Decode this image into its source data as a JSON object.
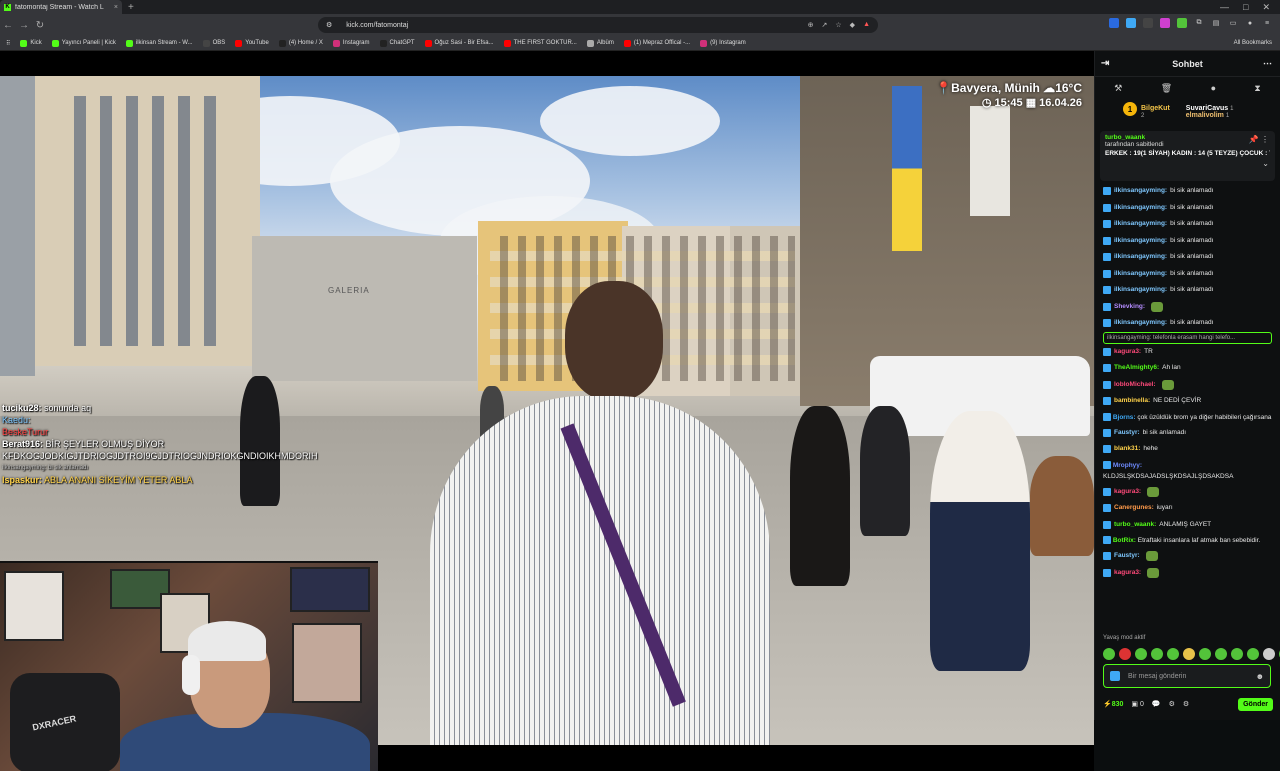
{
  "browser": {
    "tab_title": "fatomontaj Stream - Watch L",
    "tab_close": "×",
    "new_tab": "+",
    "url": "kick.com/fatomontaj",
    "bookmarks": [
      "Kick",
      "Yayıncı Paneli | Kick",
      "ilkinsan Stream - W...",
      "OBS",
      "YouTube",
      "(4) Home / X",
      "Instagram",
      "ChatGPT",
      "Oğuz Sasi - Bir Efsa...",
      "THE FIRST GOKTUR...",
      "Albüm",
      "(1) Mepraz Offical -...",
      "(9) Instagram"
    ],
    "all_bookmarks": "All Bookmarks"
  },
  "stream": {
    "location": "Bavyera, Münih",
    "temp": "16°C",
    "time": "15:45",
    "date": "16.04.26",
    "store_sign": "GALERIA"
  },
  "overlay_chat": [
    {
      "user": "tuciku28:",
      "text": "sonunda aq",
      "color": "#ffffff"
    },
    {
      "user": "",
      "text": "Kaedu:",
      "color": "#7fc8ff"
    },
    {
      "user": "",
      "text": "BeskeTurur",
      "color": "#ff4040"
    },
    {
      "user": "Berat916:",
      "text": "BİR ŞEYLER OLMUŞ DİYOR",
      "color": "#ffffff"
    },
    {
      "user": "",
      "text": "KFDKOGJODKIGJTDRIOGJDTROI9GJDTRIOGJNDRIOKGNDIOIKHMDORIH",
      "color": "#ffffff"
    },
    {
      "user": "",
      "text": "ilkinsangayming: bi sik anlamadı",
      "color": "#bbbbbb"
    },
    {
      "user": "lspaskur:",
      "text": "ABLA ANANI SİKEYİM YETER ABLA",
      "color": "#ffd24a"
    }
  ],
  "cam": {
    "chair_text": "DXRACER"
  },
  "chat": {
    "title": "Sohbet",
    "gifters": [
      {
        "rank": "1",
        "name": "BilgeKut",
        "count": "2"
      },
      {
        "name": "SuvariCavus",
        "count": "1"
      },
      {
        "name": "elmalivolim",
        "count": "1"
      }
    ],
    "pinned": {
      "by": "turbo_waank",
      "by_suffix": "tarafından sabitlendi",
      "text": "ERKEK : 19(1 SİYAH) KADIN : 14 (5 TEYZE) ÇOCUK : 7 SİYAH SAÇLI KIZ..."
    },
    "messages": [
      {
        "user": "ilkinsangayming:",
        "text": "bi sik anlamadı",
        "color": "#7fc8ff"
      },
      {
        "user": "ilkinsangayming:",
        "text": "bi sik anlamadı",
        "color": "#7fc8ff"
      },
      {
        "user": "ilkinsangayming:",
        "text": "bi sik anlamadı",
        "color": "#7fc8ff"
      },
      {
        "user": "ilkinsangayming:",
        "text": "bi sik anlamadı",
        "color": "#7fc8ff"
      },
      {
        "user": "ilkinsangayming:",
        "text": "bi sik anlamadı",
        "color": "#7fc8ff"
      },
      {
        "user": "ilkinsangayming:",
        "text": "bi sik anlamadı",
        "color": "#7fc8ff"
      },
      {
        "user": "ilkinsangayming:",
        "text": "bi sik anlamadı",
        "color": "#7fc8ff"
      },
      {
        "user": "Shevking:",
        "text": "",
        "color": "#b48cff"
      },
      {
        "user": "ilkinsangayming:",
        "text": "bi sik anlamadı",
        "color": "#7fc8ff"
      }
    ],
    "reply": "ilkinsangayming: telefonla erasam hangi telefo...",
    "messages2": [
      {
        "user": "kagura3:",
        "text": "TR",
        "color": "#ff4a7a"
      },
      {
        "user": "TheAlmighty6:",
        "text": "Ah lan",
        "color": "#53fc18"
      },
      {
        "user": "lobloMichael:",
        "text": "",
        "color": "#ff4a7a"
      },
      {
        "user": "bambinella:",
        "text": "NE DEDİ ÇEVİR",
        "color": "#ffd24a"
      },
      {
        "user": "Bjorns:",
        "text": "çok üzüldük brom ya diğer habibileri çağırsana",
        "color": "#3fa9f5"
      },
      {
        "user": "Faustyr:",
        "text": "bi sik anlamadı",
        "color": "#7fc8ff"
      },
      {
        "user": "blank31:",
        "text": "hehe",
        "color": "#ffd24a"
      },
      {
        "user": "Mrophyy:",
        "text": "KLDJSLŞKDSAJADSLŞKDSAJLŞDSAKDSA",
        "color": "#6f8cff"
      },
      {
        "user": "kagura3:",
        "text": "",
        "color": "#ff4a7a"
      },
      {
        "user": "Canergunes:",
        "text": "iuyarı",
        "color": "#ff9a4a"
      },
      {
        "user": "turbo_waank:",
        "text": "ANLAMIŞ GAYET",
        "color": "#53fc18"
      },
      {
        "user": "BotRix:",
        "text": "Etraftaki insanlara laf atmak ban sebebidir.",
        "color": "#53fc18"
      },
      {
        "user": "Faustyr:",
        "text": "",
        "color": "#7fc8ff"
      },
      {
        "user": "kagura3:",
        "text": "",
        "color": "#ff4a7a"
      }
    ],
    "slow_mode": "Yavaş mod aktif",
    "input_placeholder": "Bir mesaj gönderin",
    "points": "830",
    "count2": "0",
    "send": "Gönder"
  }
}
